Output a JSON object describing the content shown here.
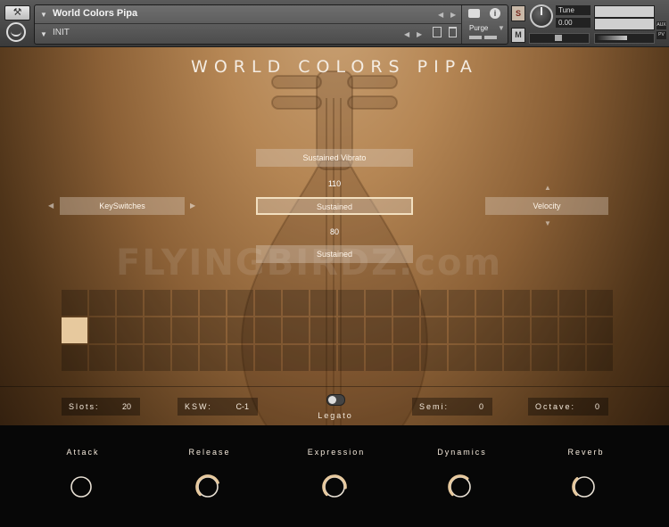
{
  "header": {
    "instrument_name": "World Colors Pipa",
    "preset_name": "INIT",
    "purge_label": "Purge",
    "tune_label": "Tune",
    "tune_value": "0.00",
    "s_button": "S",
    "m_button": "M",
    "aux_label": "AUX",
    "pv_label": "PV"
  },
  "title": "WORLD COLORS PIPA",
  "articulation": {
    "top_button": "Sustained Vibrato",
    "upper_value": "110",
    "selected_button": "Sustained",
    "lower_value": "80",
    "bottom_button": "Sustained"
  },
  "left_selector": {
    "label": "KeySwitches"
  },
  "right_selector": {
    "label": "Velocity"
  },
  "watermark": "FLYINGBIRDZ.com",
  "grid": {
    "rows": 3,
    "cols": 20,
    "active_row": 1,
    "active_col": 0
  },
  "controls": {
    "slots_label": "Slots:",
    "slots_value": "20",
    "ksw_label": "KSW:",
    "ksw_value": "C-1",
    "legato_label": "Legato",
    "semi_label": "Semi:",
    "semi_value": "0",
    "octave_label": "Octave:",
    "octave_value": "0"
  },
  "knobs": [
    {
      "label": "Attack",
      "level": 0.0
    },
    {
      "label": "Release",
      "level": 0.75
    },
    {
      "label": "Expression",
      "level": 0.85
    },
    {
      "label": "Dynamics",
      "level": 0.65
    },
    {
      "label": "Reverb",
      "level": 0.35
    }
  ],
  "colors": {
    "accent": "#e7c99e",
    "panel_bg": "#070707"
  }
}
